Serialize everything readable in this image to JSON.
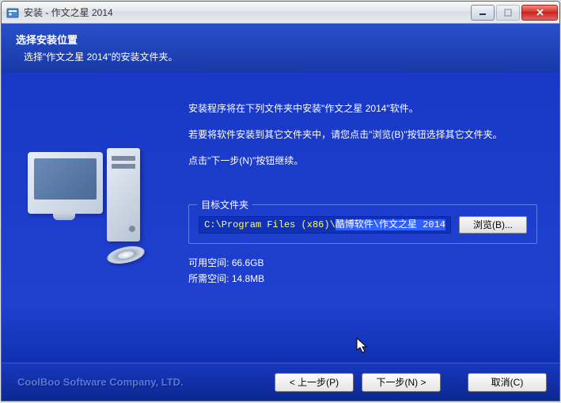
{
  "titlebar": {
    "text": "安装 - 作文之星 2014"
  },
  "header": {
    "title": "选择安装位置",
    "sub": "选择\"作文之星 2014\"的安装文件夹。"
  },
  "content": {
    "line1": "安装程序将在下列文件夹中安装\"作文之星 2014\"软件。",
    "line2": "若要将软件安装到其它文件夹中，请您点击\"浏览(B)\"按钮选择其它文件夹。",
    "line3": "点击\"下一步(N)\"按钮继续。"
  },
  "fieldset": {
    "legend": "目标文件夹",
    "path_prefix": "C:\\Program Files (x86)\\",
    "path_selected": "酷博软件\\作文之星 2014",
    "browse": "浏览(B)..."
  },
  "space": {
    "available_label": "可用空间: ",
    "available_value": "66.6GB",
    "required_label": "所需空间: ",
    "required_value": "14.8MB"
  },
  "footer": {
    "brand": "CoolBoo Software Company, LTD.",
    "back": "< 上一步(P)",
    "next": "下一步(N) >",
    "cancel": "取消(C)"
  }
}
